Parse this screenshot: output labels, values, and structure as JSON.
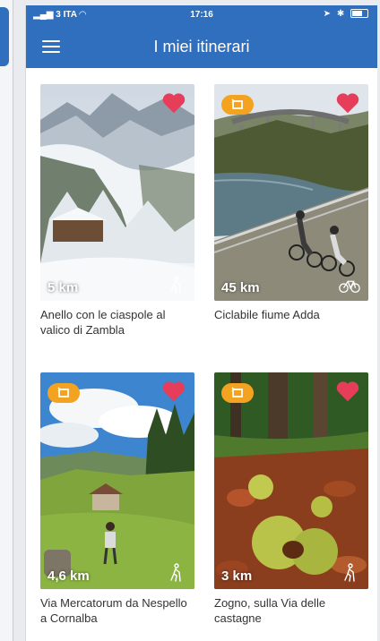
{
  "status_bar": {
    "carrier": "3 ITA",
    "time": "17:16"
  },
  "header": {
    "title": "I miei itinerari",
    "menu_icon": "hamburger-menu-icon"
  },
  "colors": {
    "primary": "#2f6fbd",
    "heart": "#e63d5a",
    "loop_badge": "#f3a31f"
  },
  "itineraries": [
    {
      "name": "Anello con le ciaspole al valico di Zambla",
      "distance": "5 km",
      "favorite": true,
      "loop": false,
      "mode": "hiking-icon"
    },
    {
      "name": "Ciclabile fiume Adda",
      "distance": "45 km",
      "favorite": true,
      "loop": true,
      "mode": "bicycle-icon"
    },
    {
      "name": "Via Mercatorum da Nespello a Cornalba",
      "distance": "4,6 km",
      "favorite": true,
      "loop": true,
      "mode": "hiking-icon"
    },
    {
      "name": "Zogno, sulla Via delle castagne",
      "distance": "3 km",
      "favorite": true,
      "loop": true,
      "mode": "hiking-icon"
    }
  ]
}
